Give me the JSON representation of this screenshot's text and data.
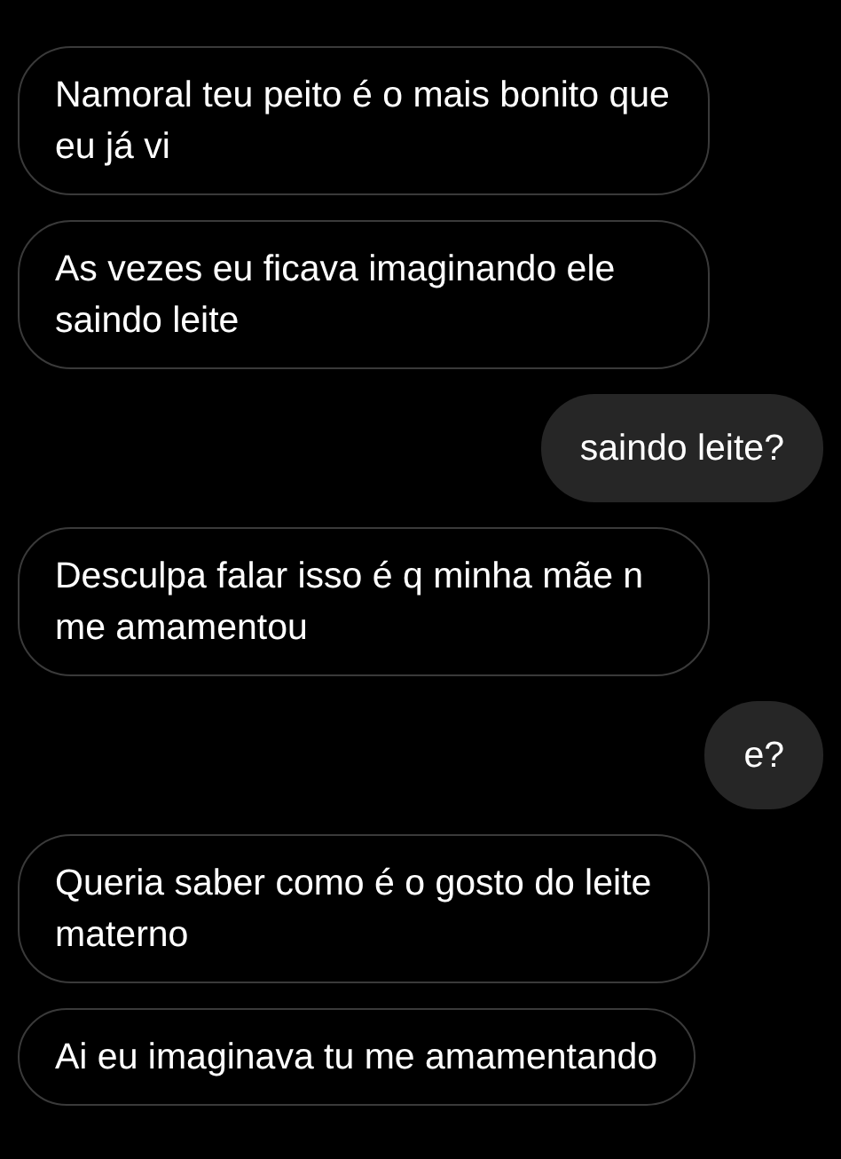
{
  "messages": [
    {
      "kind": "received",
      "text": "Namoral teu peito é o mais bonito que eu já vi"
    },
    {
      "kind": "received",
      "text": "As vezes eu ficava imaginando ele saindo leite"
    },
    {
      "kind": "sent",
      "text": "saindo leite?"
    },
    {
      "kind": "received",
      "text": "Desculpa falar isso é q minha mãe n me amamentou"
    },
    {
      "kind": "sent",
      "text": "e?"
    },
    {
      "kind": "received",
      "text": "Queria saber como é o gosto do leite materno"
    },
    {
      "kind": "received",
      "text": "Ai eu imaginava tu me amamentando"
    }
  ]
}
